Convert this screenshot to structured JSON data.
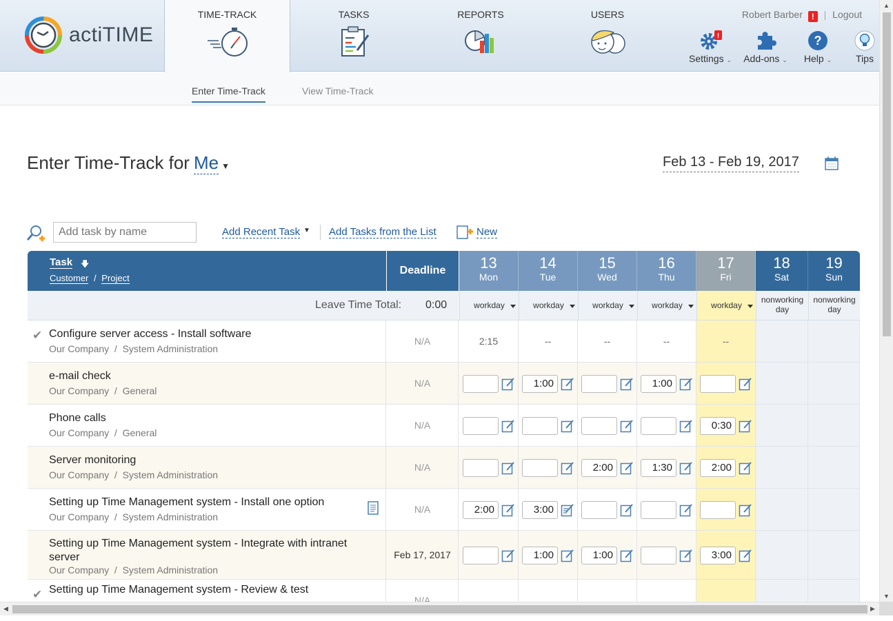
{
  "app": {
    "logo_text": "actiTIME"
  },
  "nav": {
    "tabs": [
      {
        "label": "TIME-TRACK",
        "icon": "stopwatch-icon"
      },
      {
        "label": "TASKS",
        "icon": "clipboard-icon"
      },
      {
        "label": "REPORTS",
        "icon": "chart-icon"
      },
      {
        "label": "USERS",
        "icon": "users-icon"
      }
    ]
  },
  "user": {
    "name": "Robert Barber",
    "alert": "!",
    "separator": "|",
    "logout": "Logout"
  },
  "tools": [
    {
      "label": "Settings",
      "icon": "gear-icon",
      "badge": "!"
    },
    {
      "label": "Add-ons",
      "icon": "puzzle-icon"
    },
    {
      "label": "Help",
      "icon": "help-icon",
      "glyph": "?"
    },
    {
      "label": "Tips",
      "icon": "lightbulb-icon"
    }
  ],
  "subnav": {
    "enter": "Enter Time-Track",
    "view": "View Time-Track"
  },
  "title": {
    "prefix": "Enter Time-Track for",
    "who": "Me"
  },
  "date_range": "Feb 13 - Feb 19, 2017",
  "addbar": {
    "placeholder": "Add task by name",
    "recent": "Add Recent Task",
    "from_list": "Add Tasks from the List",
    "new": "New"
  },
  "grid": {
    "head": {
      "task": "Task",
      "customer": "Customer",
      "slash": "/",
      "project": "Project",
      "deadline": "Deadline"
    },
    "days": [
      {
        "num": "13",
        "name": "Mon",
        "status": "workday"
      },
      {
        "num": "14",
        "name": "Tue",
        "status": "workday"
      },
      {
        "num": "15",
        "name": "Wed",
        "status": "workday"
      },
      {
        "num": "16",
        "name": "Thu",
        "status": "workday"
      },
      {
        "num": "17",
        "name": "Fri",
        "status": "workday"
      },
      {
        "num": "18",
        "name": "Sat",
        "status": "nonworking day"
      },
      {
        "num": "19",
        "name": "Sun",
        "status": "nonworking day"
      }
    ],
    "leave_label": "Leave Time Total:",
    "leave_value": "0:00",
    "rows": [
      {
        "name": "Configure server access - Install software",
        "sub": "Our Company  /  System Administration",
        "deadline": "N/A",
        "done": true,
        "static": [
          "2:15",
          "--",
          "--",
          "--",
          "--"
        ]
      },
      {
        "name": "e-mail check",
        "sub": "Our Company  /  General",
        "deadline": "N/A",
        "times": [
          "",
          "1:00",
          "",
          "1:00",
          ""
        ]
      },
      {
        "name": "Phone calls",
        "sub": "Our Company  /  General",
        "deadline": "N/A",
        "times": [
          "",
          "",
          "",
          "",
          "0:30"
        ]
      },
      {
        "name": "Server monitoring",
        "sub": "Our Company  /  System Administration",
        "deadline": "N/A",
        "times": [
          "",
          "",
          "2:00",
          "1:30",
          "2:00"
        ]
      },
      {
        "name": "Setting up Time Management system - Install one option",
        "sub": "Our Company  /  System Administration",
        "deadline": "N/A",
        "note": true,
        "times": [
          "2:00",
          "3:00",
          "",
          "",
          ""
        ]
      },
      {
        "name": "Setting up Time Management system - Integrate with intranet server",
        "sub": "Our Company  /  System Administration",
        "deadline": "Feb 17, 2017",
        "times": [
          "",
          "1:00",
          "1:00",
          "",
          "3:00"
        ]
      },
      {
        "name": "Setting up Time Management system - Review & test",
        "sub": "",
        "deadline": "N/A",
        "done": true,
        "static": [
          "",
          "",
          "",
          "",
          ""
        ]
      }
    ]
  },
  "colors": {
    "header_blue": "#33699a",
    "workday_head": "#7799bf",
    "today_bg": "#fff4b8",
    "link": "#1e5a9c"
  }
}
